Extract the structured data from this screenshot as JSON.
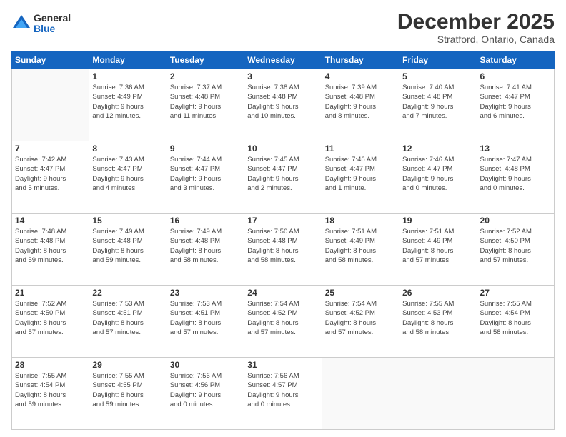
{
  "logo": {
    "general": "General",
    "blue": "Blue"
  },
  "title": "December 2025",
  "location": "Stratford, Ontario, Canada",
  "days_header": [
    "Sunday",
    "Monday",
    "Tuesday",
    "Wednesday",
    "Thursday",
    "Friday",
    "Saturday"
  ],
  "weeks": [
    [
      {
        "day": "",
        "detail": ""
      },
      {
        "day": "1",
        "detail": "Sunrise: 7:36 AM\nSunset: 4:49 PM\nDaylight: 9 hours\nand 12 minutes."
      },
      {
        "day": "2",
        "detail": "Sunrise: 7:37 AM\nSunset: 4:48 PM\nDaylight: 9 hours\nand 11 minutes."
      },
      {
        "day": "3",
        "detail": "Sunrise: 7:38 AM\nSunset: 4:48 PM\nDaylight: 9 hours\nand 10 minutes."
      },
      {
        "day": "4",
        "detail": "Sunrise: 7:39 AM\nSunset: 4:48 PM\nDaylight: 9 hours\nand 8 minutes."
      },
      {
        "day": "5",
        "detail": "Sunrise: 7:40 AM\nSunset: 4:48 PM\nDaylight: 9 hours\nand 7 minutes."
      },
      {
        "day": "6",
        "detail": "Sunrise: 7:41 AM\nSunset: 4:47 PM\nDaylight: 9 hours\nand 6 minutes."
      }
    ],
    [
      {
        "day": "7",
        "detail": "Sunrise: 7:42 AM\nSunset: 4:47 PM\nDaylight: 9 hours\nand 5 minutes."
      },
      {
        "day": "8",
        "detail": "Sunrise: 7:43 AM\nSunset: 4:47 PM\nDaylight: 9 hours\nand 4 minutes."
      },
      {
        "day": "9",
        "detail": "Sunrise: 7:44 AM\nSunset: 4:47 PM\nDaylight: 9 hours\nand 3 minutes."
      },
      {
        "day": "10",
        "detail": "Sunrise: 7:45 AM\nSunset: 4:47 PM\nDaylight: 9 hours\nand 2 minutes."
      },
      {
        "day": "11",
        "detail": "Sunrise: 7:46 AM\nSunset: 4:47 PM\nDaylight: 9 hours\nand 1 minute."
      },
      {
        "day": "12",
        "detail": "Sunrise: 7:46 AM\nSunset: 4:47 PM\nDaylight: 9 hours\nand 0 minutes."
      },
      {
        "day": "13",
        "detail": "Sunrise: 7:47 AM\nSunset: 4:48 PM\nDaylight: 9 hours\nand 0 minutes."
      }
    ],
    [
      {
        "day": "14",
        "detail": "Sunrise: 7:48 AM\nSunset: 4:48 PM\nDaylight: 8 hours\nand 59 minutes."
      },
      {
        "day": "15",
        "detail": "Sunrise: 7:49 AM\nSunset: 4:48 PM\nDaylight: 8 hours\nand 59 minutes."
      },
      {
        "day": "16",
        "detail": "Sunrise: 7:49 AM\nSunset: 4:48 PM\nDaylight: 8 hours\nand 58 minutes."
      },
      {
        "day": "17",
        "detail": "Sunrise: 7:50 AM\nSunset: 4:48 PM\nDaylight: 8 hours\nand 58 minutes."
      },
      {
        "day": "18",
        "detail": "Sunrise: 7:51 AM\nSunset: 4:49 PM\nDaylight: 8 hours\nand 58 minutes."
      },
      {
        "day": "19",
        "detail": "Sunrise: 7:51 AM\nSunset: 4:49 PM\nDaylight: 8 hours\nand 57 minutes."
      },
      {
        "day": "20",
        "detail": "Sunrise: 7:52 AM\nSunset: 4:50 PM\nDaylight: 8 hours\nand 57 minutes."
      }
    ],
    [
      {
        "day": "21",
        "detail": "Sunrise: 7:52 AM\nSunset: 4:50 PM\nDaylight: 8 hours\nand 57 minutes."
      },
      {
        "day": "22",
        "detail": "Sunrise: 7:53 AM\nSunset: 4:51 PM\nDaylight: 8 hours\nand 57 minutes."
      },
      {
        "day": "23",
        "detail": "Sunrise: 7:53 AM\nSunset: 4:51 PM\nDaylight: 8 hours\nand 57 minutes."
      },
      {
        "day": "24",
        "detail": "Sunrise: 7:54 AM\nSunset: 4:52 PM\nDaylight: 8 hours\nand 57 minutes."
      },
      {
        "day": "25",
        "detail": "Sunrise: 7:54 AM\nSunset: 4:52 PM\nDaylight: 8 hours\nand 57 minutes."
      },
      {
        "day": "26",
        "detail": "Sunrise: 7:55 AM\nSunset: 4:53 PM\nDaylight: 8 hours\nand 58 minutes."
      },
      {
        "day": "27",
        "detail": "Sunrise: 7:55 AM\nSunset: 4:54 PM\nDaylight: 8 hours\nand 58 minutes."
      }
    ],
    [
      {
        "day": "28",
        "detail": "Sunrise: 7:55 AM\nSunset: 4:54 PM\nDaylight: 8 hours\nand 59 minutes."
      },
      {
        "day": "29",
        "detail": "Sunrise: 7:55 AM\nSunset: 4:55 PM\nDaylight: 8 hours\nand 59 minutes."
      },
      {
        "day": "30",
        "detail": "Sunrise: 7:56 AM\nSunset: 4:56 PM\nDaylight: 9 hours\nand 0 minutes."
      },
      {
        "day": "31",
        "detail": "Sunrise: 7:56 AM\nSunset: 4:57 PM\nDaylight: 9 hours\nand 0 minutes."
      },
      {
        "day": "",
        "detail": ""
      },
      {
        "day": "",
        "detail": ""
      },
      {
        "day": "",
        "detail": ""
      }
    ]
  ]
}
